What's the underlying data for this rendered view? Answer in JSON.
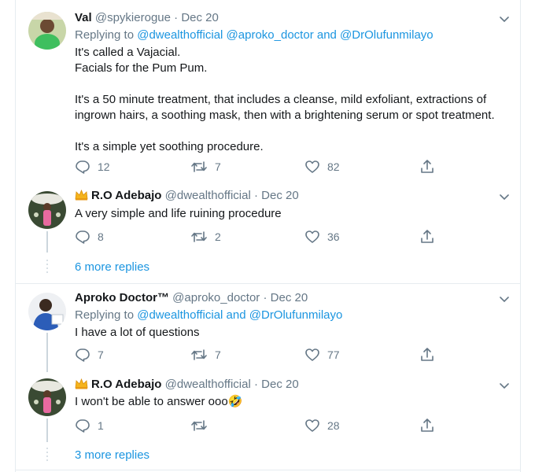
{
  "tweets": [
    {
      "name": "Val",
      "handle": "@spykierogue",
      "date": "Dec 20",
      "replying_prefix": "Replying to",
      "replying_handles": "@dwealthofficial @aproko_doctor and @DrOlufunmilayo",
      "text": "It's called a Vajacial.\nFacials for the Pum Pum.\n\nIt's a 50 minute treatment, that includes a cleanse, mild exfoliant, extractions of\ningrown hairs, a soothing mask, then with a brightening serum or spot treatment.\n\nIt's a simple yet soothing procedure.",
      "replies": "12",
      "retweets": "7",
      "likes": "82"
    },
    {
      "name": "R.O Adebajo",
      "handle": "@dwealthofficial",
      "date": "Dec 20",
      "text": "A very simple and life ruining procedure",
      "replies": "8",
      "retweets": "2",
      "likes": "36"
    },
    {
      "name": "Aproko Doctor™",
      "handle": "@aproko_doctor",
      "date": "Dec 20",
      "replying_prefix": "Replying to",
      "replying_handles": "@dwealthofficial and @DrOlufunmilayo",
      "text": "I have a lot of questions",
      "replies": "7",
      "retweets": "7",
      "likes": "77"
    },
    {
      "name": "R.O Adebajo",
      "handle": "@dwealthofficial",
      "date": "Dec 20",
      "text": "I won't be able to answer ooo🤣",
      "replies": "1",
      "retweets": "",
      "likes": "28"
    }
  ],
  "more_replies": [
    "6 more replies",
    "3 more replies"
  ],
  "date_separator": "·",
  "icons": {
    "reply": "reply-icon",
    "retweet": "retweet-icon",
    "like": "heart-icon",
    "share": "share-icon",
    "menu": "chevron-down-icon",
    "crown": "crown-emoji-icon"
  },
  "colors": {
    "link": "#1b95e0",
    "muted": "#657786",
    "text": "#14171a",
    "border": "#e6ecf0"
  }
}
